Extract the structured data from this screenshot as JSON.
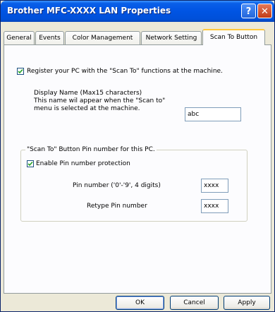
{
  "window": {
    "title": "Brother MFC-XXXX LAN Properties",
    "help_symbol": "?",
    "close_symbol": "✕"
  },
  "tabs": [
    {
      "label": "General"
    },
    {
      "label": "Events"
    },
    {
      "label": "Color Management"
    },
    {
      "label": "Network Setting"
    },
    {
      "label": "Scan To Button",
      "active": true
    }
  ],
  "register": {
    "label": "Register your PC with the \"Scan To\" functions at the machine.",
    "checked": true
  },
  "display_name": {
    "lines": [
      "Display Name (Max15 characters)",
      "This name wil appear when the \"Scan to\"",
      "menu is selected at the machine."
    ],
    "value": "abc"
  },
  "pin_group": {
    "legend": "\"Scan To\" Button Pin number for this PC.",
    "enable_label": "Enable Pin number protection",
    "enable_checked": true,
    "pin_label": "Pin number ('0'-'9', 4 digits)",
    "pin_value": "xxxx",
    "retype_label": "Retype Pin number",
    "retype_value": "xxxx"
  },
  "buttons": {
    "ok": "OK",
    "cancel": "Cancel",
    "apply": "Apply"
  },
  "colors": {
    "title_bar": "#0054e3",
    "dialog_face": "#ece9d8",
    "active_tab_highlight": "#ffc83c"
  }
}
